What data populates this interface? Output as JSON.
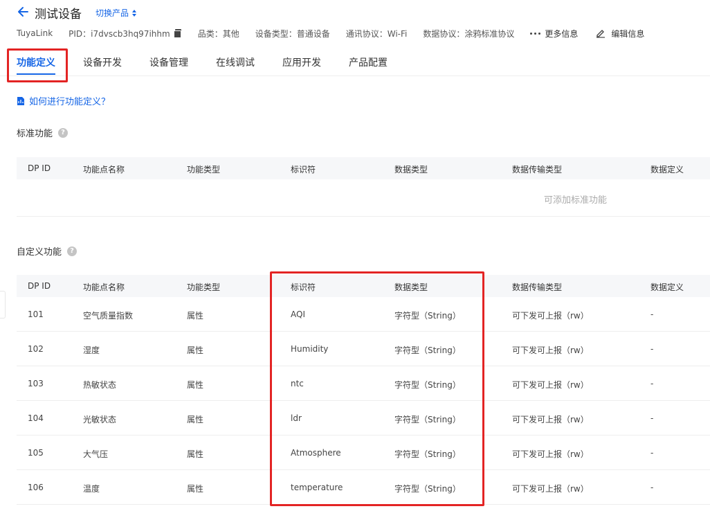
{
  "header": {
    "title": "测试设备",
    "switch_label": "切换产品",
    "meta": {
      "link": "TuyaLink",
      "pid": "PID：i7dvscb3hq97ihhm",
      "category": "品类：其他",
      "device_type": "设备类型：普通设备",
      "protocol": "通讯协议：Wi-Fi",
      "data_protocol": "数据协议：涂鸦标准协议",
      "more": "更多信息",
      "edit": "编辑信息"
    }
  },
  "tabs": [
    "功能定义",
    "设备开发",
    "设备管理",
    "在线调试",
    "应用开发",
    "产品配置"
  ],
  "help_link": "如何进行功能定义？",
  "standard": {
    "title": "标准功能",
    "empty": "可添加标准功能"
  },
  "custom": {
    "title": "自定义功能"
  },
  "columns": [
    "DP ID",
    "功能点名称",
    "功能类型",
    "标识符",
    "数据类型",
    "数据传输类型",
    "数据定义"
  ],
  "rows": [
    [
      "101",
      "空气质量指数",
      "属性",
      "AQI",
      "字符型（String）",
      "可下发可上报（rw）",
      "-"
    ],
    [
      "102",
      "湿度",
      "属性",
      "Humidity",
      "字符型（String）",
      "可下发可上报（rw）",
      "-"
    ],
    [
      "103",
      "热敏状态",
      "属性",
      "ntc",
      "字符型（String）",
      "可下发可上报（rw）",
      "-"
    ],
    [
      "104",
      "光敏状态",
      "属性",
      "ldr",
      "字符型（String）",
      "可下发可上报（rw）",
      "-"
    ],
    [
      "105",
      "大气压",
      "属性",
      "Atmosphere",
      "字符型（String）",
      "可下发可上报（rw）",
      "-"
    ],
    [
      "106",
      "温度",
      "属性",
      "temperature",
      "字符型（String）",
      "可下发可上报（rw）",
      "-"
    ]
  ],
  "colors": {
    "accent": "#1565e6",
    "highlight": "#e32424"
  }
}
